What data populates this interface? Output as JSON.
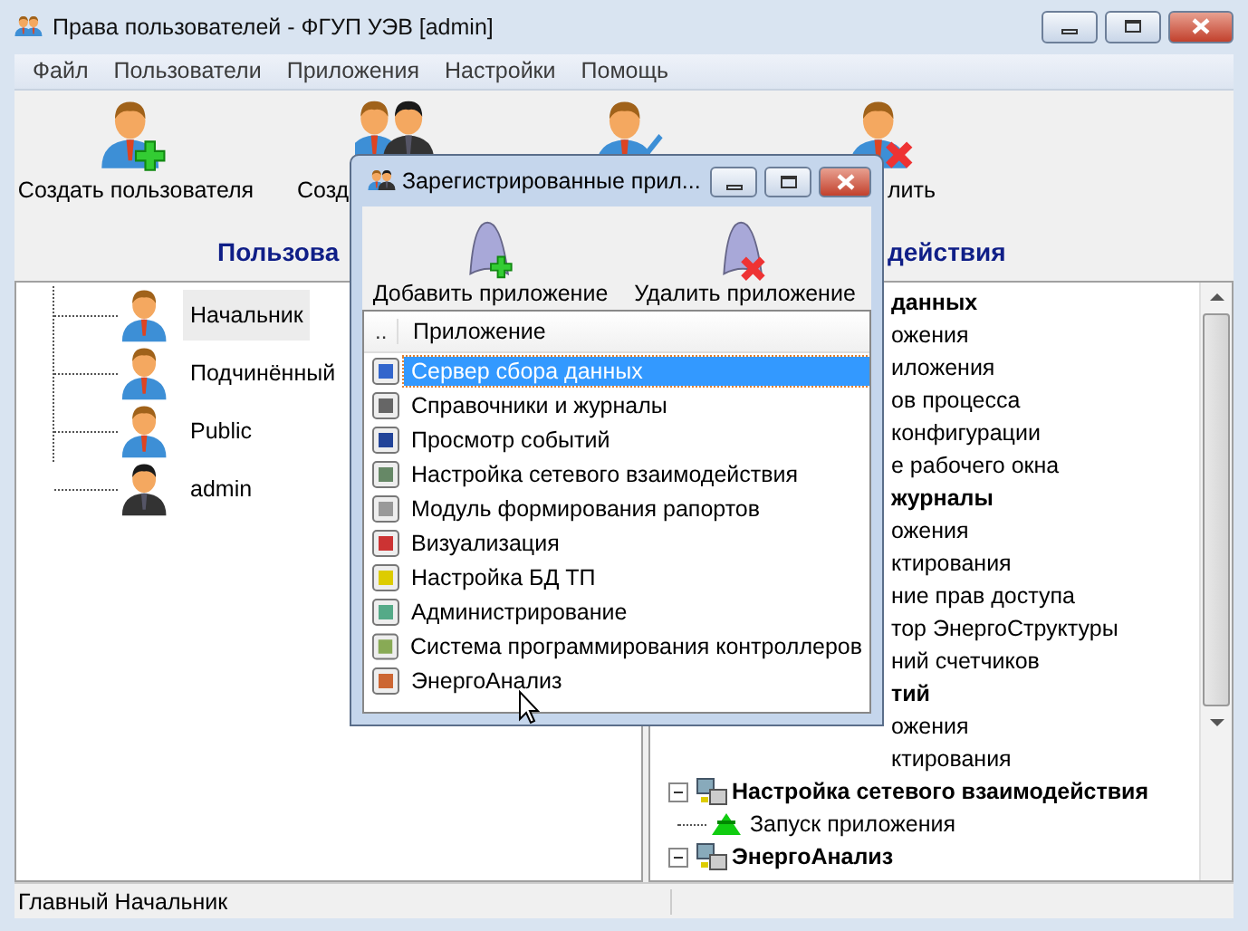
{
  "window": {
    "title": "Права пользователей - ФГУП УЭВ [admin]"
  },
  "menu": [
    "Файл",
    "Пользователи",
    "Приложения",
    "Настройки",
    "Помощь"
  ],
  "toolbar": [
    {
      "label": "Создать пользователя",
      "kind": "add-user"
    },
    {
      "label": "Созд",
      "kind": "group"
    },
    {
      "kind": "edit-user"
    },
    {
      "label": "лить",
      "kind": "delete-user"
    }
  ],
  "headings": [
    "Пользова",
    "действия"
  ],
  "users": [
    {
      "name": "Начальник",
      "kind": "user",
      "selected": true
    },
    {
      "name": "Подчинённый",
      "kind": "user",
      "selected": false
    },
    {
      "name": "Public",
      "kind": "user",
      "selected": false
    },
    {
      "name": "admin",
      "kind": "admin",
      "selected": false
    }
  ],
  "permissions_tree": [
    {
      "label": "данных",
      "kind": "cut",
      "children": [
        {
          "label": "ожения"
        },
        {
          "label": "иложения"
        },
        {
          "label": "ов процесса"
        },
        {
          "label": "конфигурации"
        },
        {
          "label": "е рабочего окна"
        }
      ]
    },
    {
      "label": "журналы",
      "kind": "cut",
      "children": [
        {
          "label": "ожения"
        },
        {
          "label": "ктирования"
        },
        {
          "label": "ние прав доступа"
        },
        {
          "label": "тор ЭнергоСтруктуры"
        },
        {
          "label": "ний счетчиков"
        }
      ]
    },
    {
      "label": "тий",
      "kind": "cut",
      "children": [
        {
          "label": "ожения"
        },
        {
          "label": "ктирования"
        }
      ]
    },
    {
      "label": "Настройка сетевого взаимодействия",
      "kind": "full",
      "expanded": true,
      "children": [
        {
          "label": "Запуск приложения"
        }
      ]
    },
    {
      "label": "ЭнергоАнализ",
      "kind": "full",
      "expanded": true
    }
  ],
  "status_bar": [
    "Главный Начальник"
  ],
  "dialog": {
    "title": "Зарегистрированные прил...",
    "toolbar": [
      {
        "label": "Добавить приложение",
        "kind": "add"
      },
      {
        "label": "Удалить приложение",
        "kind": "remove"
      }
    ],
    "columns": [
      "..",
      "Приложение"
    ],
    "rows": [
      {
        "label": "Сервер сбора данных",
        "selected": true
      },
      {
        "label": "Справочники и журналы",
        "selected": false
      },
      {
        "label": "Просмотр событий",
        "selected": false
      },
      {
        "label": "Настройка сетевого взаимодействия",
        "selected": false
      },
      {
        "label": "Модуль формирования рапортов",
        "selected": false
      },
      {
        "label": "Визуализация",
        "selected": false
      },
      {
        "label": "Настройка БД ТП",
        "selected": false
      },
      {
        "label": "Администрирование",
        "selected": false
      },
      {
        "label": "Система программирования контроллеров",
        "selected": false
      },
      {
        "label": "ЭнергоАнализ",
        "selected": false
      }
    ]
  }
}
